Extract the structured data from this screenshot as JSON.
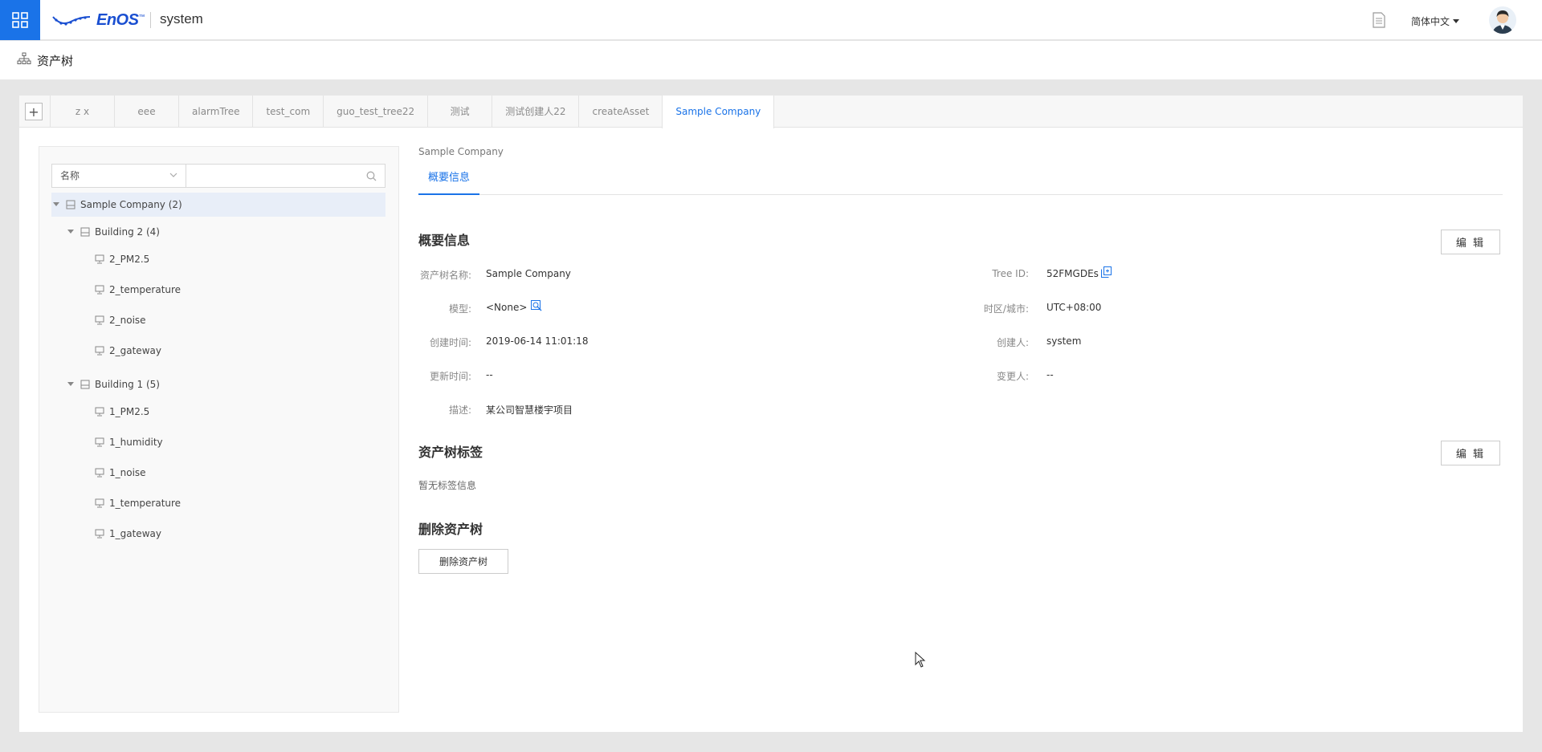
{
  "header": {
    "logo_text": "EnOS",
    "logo_tm": "™",
    "app_name": "system",
    "language": "简体中文"
  },
  "page_title": "资产树",
  "tabs": {
    "add_label": "+",
    "items": [
      "z x",
      "eee",
      "alarmTree",
      "test_com",
      "guo_test_tree22",
      "测试",
      "测试创建人22",
      "createAsset",
      "Sample Company"
    ],
    "active_index": 8
  },
  "tree_search": {
    "select_value": "名称",
    "input_value": "",
    "input_placeholder": ""
  },
  "tree": {
    "root": "Sample Company (2)",
    "building2": "Building 2 (4)",
    "building2_children": [
      "2_PM2.5",
      "2_temperature",
      "2_noise",
      "2_gateway"
    ],
    "building1": "Building 1 (5)",
    "building1_children": [
      "1_PM2.5",
      "1_humidity",
      "1_noise",
      "1_temperature",
      "1_gateway"
    ]
  },
  "detail": {
    "breadcrumb": "Sample Company",
    "subtab": "概要信息",
    "overview": {
      "title": "概要信息",
      "edit_label": "编 辑",
      "name_label": "资产树名称:",
      "name_value": "Sample Company",
      "treeid_label": "Tree ID:",
      "treeid_value": "52FMGDEs",
      "model_label": "模型:",
      "model_value": "<None>",
      "timezone_label": "时区/城市:",
      "timezone_value": "UTC+08:00",
      "created_label": "创建时间:",
      "created_value": "2019-06-14 11:01:18",
      "creator_label": "创建人:",
      "creator_value": "system",
      "updated_label": "更新时间:",
      "updated_value": "--",
      "modifier_label": "变更人:",
      "modifier_value": "--",
      "desc_label": "描述:",
      "desc_value": "某公司智慧楼宇项目"
    },
    "tags": {
      "title": "资产树标签",
      "edit_label": "编 辑",
      "empty_text": "暂无标签信息"
    },
    "delete": {
      "title": "删除资产树",
      "button_label": "删除资产树"
    }
  },
  "colors": {
    "accent": "#1a73e8",
    "brand": "#1a4fd1"
  }
}
